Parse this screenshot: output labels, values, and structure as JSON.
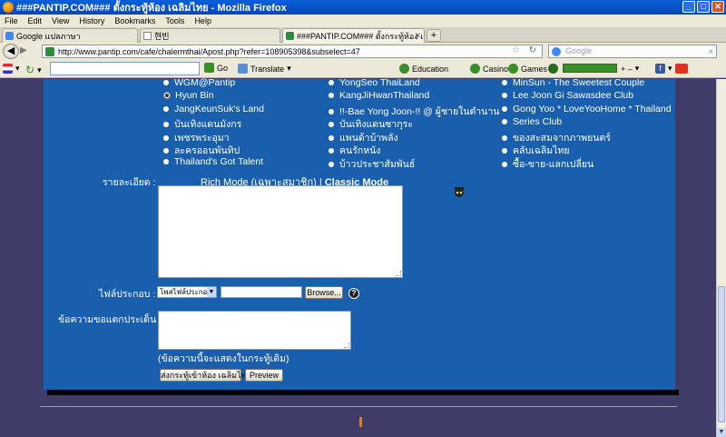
{
  "window": {
    "title": "###PANTIP.COM### ตั้งกระทู้ห้อง เฉลิมไทย - Mozilla Firefox"
  },
  "menu": [
    "File",
    "Edit",
    "View",
    "History",
    "Bookmarks",
    "Tools",
    "Help"
  ],
  "tabs": [
    {
      "label": "Google แปลภาษา"
    },
    {
      "label": "현빈"
    },
    {
      "label": "###PANTIP.COM### ตั้งกระทู้ห้อง เฉลิม..."
    }
  ],
  "nav": {
    "url": "http://www.pantip.com/cafe/chalermthai/Apost.php?refer=108905398&subselect=47",
    "search_placeholder": "Google"
  },
  "toolbar": {
    "go": "Go",
    "translate": "Translate",
    "education": "Education",
    "casino": "Casino",
    "games": "Games",
    "slider_controls": "+ –"
  },
  "clubs": {
    "col1": [
      "WGM@Pantip",
      "Hyun Bin",
      "JangKeunSuk's Land",
      "บันเทิงแดนมังกร",
      "เพชรพระอุมา",
      "ละครออนพันทิป",
      "Thailand's Got Talent"
    ],
    "col2": [
      "YongSeo ThaiLand",
      "KangJiHwanThailand",
      "!!-Bae Yong Joon-!! @ ผู้ชายในตำนาน",
      "บันเทิงแดนซากุระ",
      "แพนด้าบ้าพลัง",
      "คนรักหนัง",
      "บ้าวประชาสัมพันธ์"
    ],
    "col3": [
      "MinSun - The Sweetest Couple",
      "Lee Joon Gi Sawasdee Club",
      "Gong Yoo * LoveYooHome * Thailand",
      "Series Club",
      "ของสะสมจากภาพยนตร์",
      "คลับเฉลิมไทย",
      "ซื้อ-ขาย-แลกเปลี่ยน"
    ],
    "selected": "Hyun Bin"
  },
  "form": {
    "detail_label": "รายละเอียด :",
    "rich_mode": "Rich Mode (เฉพาะสมาชิก)",
    "separator": "|",
    "classic_mode": "Classic Mode",
    "file_label": "ไฟล์ประกอบ :",
    "file_type_selected": "โพสไฟล์ประกอบ",
    "browse": "Browse...",
    "help": "?",
    "comment_label": "ข้อความขอแตกประเด็น :",
    "comment_hint": "(ข้อความนี้จะแสดงในกระทู้เดิม)",
    "submit": "ส่งกระทู้เข้าห้อง เฉลิมไทย",
    "preview": "Preview"
  }
}
